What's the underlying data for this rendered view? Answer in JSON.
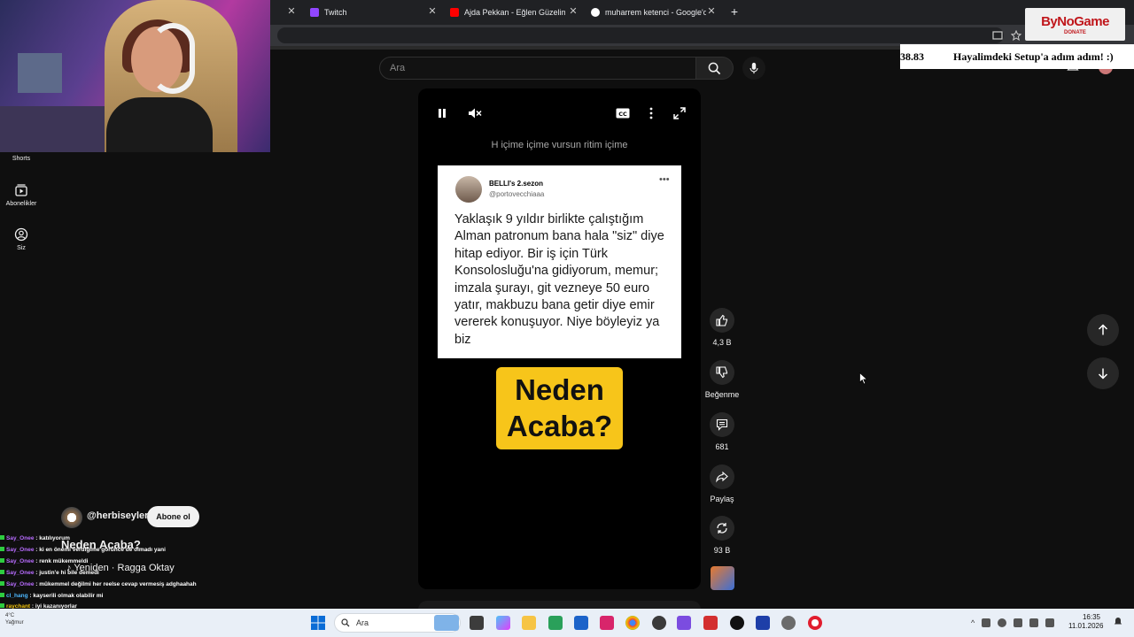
{
  "browser": {
    "tabs": [
      {
        "label": "",
        "color": "#202124"
      },
      {
        "label": "Twitch",
        "color": "#9146ff"
      },
      {
        "label": "Ajda Pekkan - Eğlen Güzelim (C",
        "color": "#ff0000"
      },
      {
        "label": "muharrem ketenci - Google'da",
        "color": "#ffffff"
      }
    ]
  },
  "youtube": {
    "search_placeholder": "Ara",
    "nav": [
      {
        "label": "Shorts"
      },
      {
        "label": "Abonelikler"
      },
      {
        "label": "Siz"
      }
    ],
    "short": {
      "caption": "H içime içime vursun ritim içime",
      "tweet": {
        "name": "BELLI's 2.sezon",
        "handle": "@portovecchiaaa",
        "body": "Yaklaşık 9 yıldır birlikte çalıştığım Alman patronum bana hala \"siz\" diye hitap ediyor. Bir iş için Türk Konsolosluğu'na gidiyorum, memur; imzala şurayı, git vezneye 50 euro yatır, makbuzu bana getir diye emir vererek konuşuyor. Niye böyleyiz ya biz"
      },
      "banner_line1": "Neden",
      "banner_line2": "Acaba?"
    },
    "actions": {
      "like_count": "4,3 B",
      "dislike_label": "Beğenme",
      "comment_count": "681",
      "share_label": "Paylaş",
      "remix_count": "93 B"
    },
    "channel": {
      "name": "@herbiseyler",
      "subscribe_label": "Abone ol",
      "title": "Neden Acaba?",
      "music": "Yeniden · Ragga Oktay"
    }
  },
  "stream_overlay": {
    "ticker_number": "38.83",
    "ticker_message": "Hayalimdeki Setup'a adım adım! :)",
    "logo_brand": "ByNoGame",
    "logo_sub": "DONATE",
    "chat": [
      {
        "user": "Say_Onee",
        "text": "katılıyorum",
        "cls": ""
      },
      {
        "user": "Say_Onee",
        "text": "ki en önemi verdiğime görünce de olmadı yani",
        "cls": ""
      },
      {
        "user": "Say_Onee",
        "text": "renk mükemmeldi",
        "cls": ""
      },
      {
        "user": "Say_Onee",
        "text": "justin'e hi bile demedi",
        "cls": ""
      },
      {
        "user": "Say_Onee",
        "text": "mükemmel değilmi her reelse cevap vermesiş adghaahah",
        "cls": ""
      },
      {
        "user": "cl_hang",
        "text": "kayserili olmak olabilir mi",
        "cls": "b"
      },
      {
        "user": "raychant",
        "text": "iyi kazanıyorlar",
        "cls": "y"
      }
    ]
  },
  "taskbar": {
    "search_placeholder": "Ara",
    "time": "16:35",
    "date": "11.01.2026",
    "weather_temp": "4°C",
    "weather_desc": "Yağmur"
  }
}
